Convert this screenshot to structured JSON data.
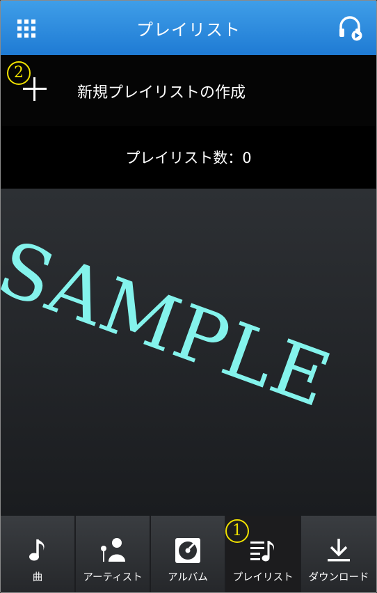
{
  "header": {
    "title": "プレイリスト",
    "menu_icon": "grid-menu-icon",
    "right_icon": "headphones-play-icon"
  },
  "create": {
    "label": "新規プレイリストの作成",
    "icon": "plus-icon"
  },
  "count": {
    "text": "プレイリスト数：0"
  },
  "watermark": "SAMPLE",
  "annotations": {
    "badge_1": "1",
    "badge_2": "2"
  },
  "nav": {
    "items": [
      {
        "label": "曲",
        "icon": "music-note-icon"
      },
      {
        "label": "アーティスト",
        "icon": "artist-icon"
      },
      {
        "label": "アルバム",
        "icon": "album-icon"
      },
      {
        "label": "プレイリスト",
        "icon": "playlist-icon",
        "active": true
      },
      {
        "label": "ダウンロード",
        "icon": "download-icon"
      }
    ]
  },
  "colors": {
    "header_blue": "#2a8be0",
    "watermark": "#84f3ec",
    "badge_yellow": "#f0e100"
  }
}
